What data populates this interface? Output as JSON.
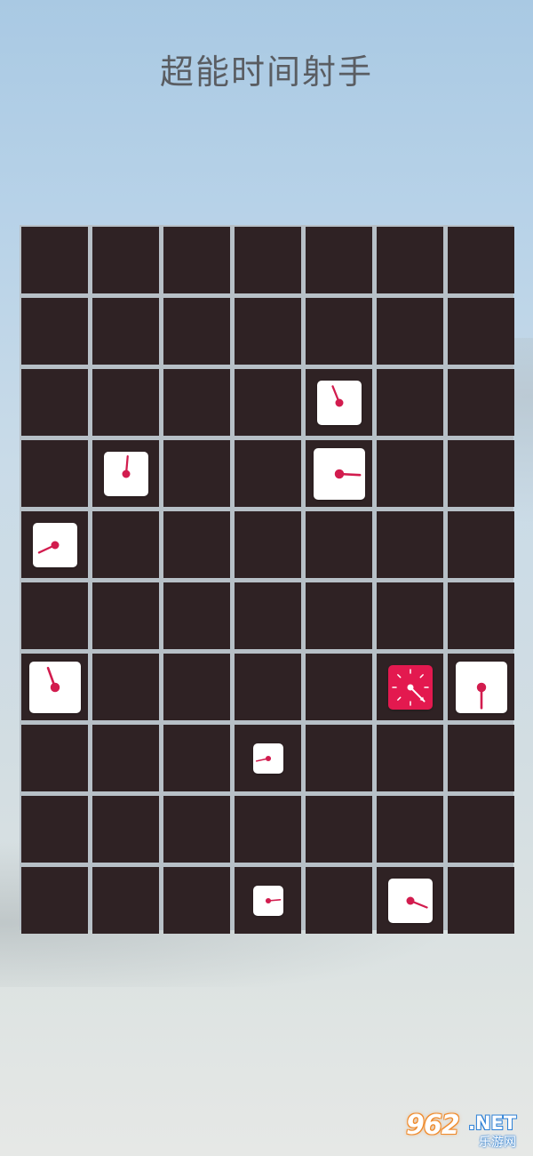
{
  "title": "超能时间射手",
  "grid": {
    "columns": 7,
    "rows": 10
  },
  "colors": {
    "cell": "#2f2224",
    "grid_line": "#b7c0c7",
    "tile": "#ffffff",
    "hand": "#d21c4e",
    "active_tile": "#e3194f",
    "active_hand": "#ffffff"
  },
  "clocks": [
    {
      "row": 2,
      "col": 4,
      "size": "medium",
      "hand_angle": -22,
      "active": false
    },
    {
      "row": 3,
      "col": 1,
      "size": "medium",
      "hand_angle": 5,
      "active": false
    },
    {
      "row": 3,
      "col": 4,
      "size": "large",
      "hand_angle": 93,
      "active": false
    },
    {
      "row": 4,
      "col": 0,
      "size": "medium",
      "hand_angle": 245,
      "active": false
    },
    {
      "row": 6,
      "col": 0,
      "size": "large",
      "hand_angle": -20,
      "active": false
    },
    {
      "row": 6,
      "col": 5,
      "size": "medium",
      "hand_angle": 135,
      "active": true
    },
    {
      "row": 6,
      "col": 6,
      "size": "large",
      "hand_angle": 180,
      "active": false
    },
    {
      "row": 7,
      "col": 3,
      "size": "small",
      "hand_angle": 258,
      "active": false
    },
    {
      "row": 9,
      "col": 3,
      "size": "small",
      "hand_angle": 85,
      "active": false
    },
    {
      "row": 9,
      "col": 5,
      "size": "medium",
      "hand_angle": 112,
      "active": false
    }
  ],
  "watermark": {
    "number": "962",
    "suffix": ".NET",
    "caption": "乐游网"
  }
}
